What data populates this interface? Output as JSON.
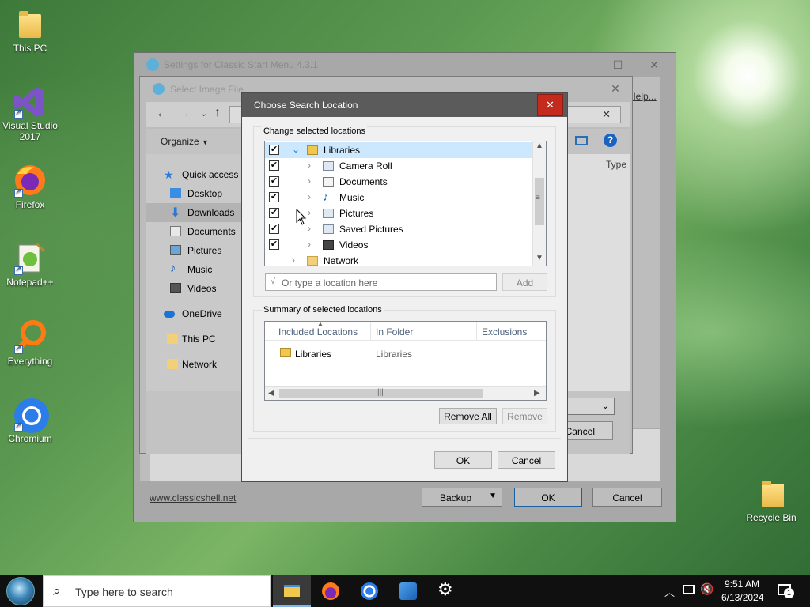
{
  "desktop": {
    "icons": [
      {
        "label": "This PC"
      },
      {
        "label": "Visual Studio 2017"
      },
      {
        "label": "Firefox"
      },
      {
        "label": "Notepad++"
      },
      {
        "label": "Everything"
      },
      {
        "label": "Chromium"
      },
      {
        "label": "Recycle Bin"
      }
    ]
  },
  "settings_window": {
    "title": "Settings for Classic Start Menu 4.3.1",
    "help_link": "Help...",
    "website_link": "www.classicshell.net",
    "backup_label": "Backup",
    "ok_label": "OK",
    "cancel_label": "Cancel"
  },
  "file_dialog": {
    "title": "Select Image File",
    "organize_label": "Organize",
    "column_type": "Type",
    "cancel_label": "Cancel",
    "sidebar": [
      {
        "label": "Quick access"
      },
      {
        "label": "Desktop"
      },
      {
        "label": "Downloads"
      },
      {
        "label": "Documents"
      },
      {
        "label": "Pictures"
      },
      {
        "label": "Music"
      },
      {
        "label": "Videos"
      },
      {
        "label": "OneDrive"
      },
      {
        "label": "This PC"
      },
      {
        "label": "Network"
      }
    ]
  },
  "search_dialog": {
    "title": "Choose Search Location",
    "close_glyph": "✕",
    "change_group_label": "Change selected locations",
    "tree": [
      {
        "label": "Libraries",
        "checked": true
      },
      {
        "label": "Camera Roll",
        "checked": true
      },
      {
        "label": "Documents",
        "checked": true
      },
      {
        "label": "Music",
        "checked": true
      },
      {
        "label": "Pictures",
        "checked": true
      },
      {
        "label": "Saved Pictures",
        "checked": true
      },
      {
        "label": "Videos",
        "checked": true
      },
      {
        "label": "Network",
        "checked": false
      }
    ],
    "location_placeholder": "Or type a location here",
    "add_label": "Add",
    "summary_group_label": "Summary of selected locations",
    "columns": {
      "included": "Included Locations",
      "in_folder": "In Folder",
      "exclusions": "Exclusions"
    },
    "rows": [
      {
        "included": "Libraries",
        "in_folder": "Libraries",
        "exclusions": ""
      }
    ],
    "remove_all_label": "Remove All",
    "remove_label": "Remove",
    "ok_label": "OK",
    "cancel_label": "Cancel"
  },
  "taskbar": {
    "search_placeholder": "Type here to search",
    "time": "9:51 AM",
    "date": "6/13/2024",
    "notification_count": "1"
  },
  "colors": {
    "close_red": "#c42b1c",
    "taskbar_bg": "#101010",
    "dialog_title": "#5b5b5b",
    "selection_blue": "#cce8ff"
  }
}
